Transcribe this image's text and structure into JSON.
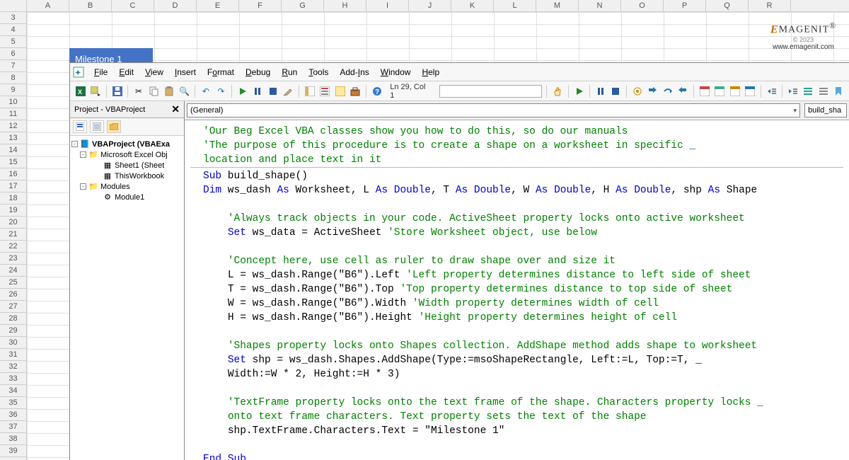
{
  "worksheet": {
    "columns": [
      "A",
      "B",
      "C",
      "D",
      "E",
      "F",
      "G",
      "H",
      "I",
      "J",
      "K",
      "L",
      "M",
      "N",
      "O",
      "P",
      "Q",
      "R"
    ],
    "first_row": 3,
    "last_row": 39,
    "shape_text": "Milestone 1"
  },
  "watermark": {
    "brand_left": "E",
    "brand_right": "MAGENIT",
    "reg": "®",
    "copyright": "© 2023",
    "url": "www.emagenit.com"
  },
  "vbe": {
    "menus": [
      "File",
      "Edit",
      "View",
      "Insert",
      "Format",
      "Debug",
      "Run",
      "Tools",
      "Add-Ins",
      "Window",
      "Help"
    ],
    "menu_underline_index": [
      0,
      0,
      0,
      0,
      1,
      0,
      0,
      0,
      4,
      0,
      0
    ],
    "toolbar_icons": [
      "excel-icon",
      "controls-dropdown-icon",
      "save-icon",
      "sep",
      "cut-icon",
      "copy-icon",
      "paste-icon",
      "find-icon",
      "sep",
      "undo-icon",
      "redo-icon",
      "sep",
      "run-icon",
      "break-icon",
      "reset-icon",
      "design-icon",
      "sep",
      "project-icon",
      "properties-icon",
      "object-browser-icon",
      "toolbox-icon",
      "sep",
      "help-icon"
    ],
    "cursor_pos": "Ln 29, Col 1",
    "toolbar2_icons": [
      "hand-icon",
      "sep",
      "play-icon",
      "sep",
      "pause-icon",
      "stop-icon",
      "sep",
      "toggle-breakpoint-icon",
      "step-into-icon",
      "step-over-icon",
      "step-out-icon",
      "sep",
      "locals-icon",
      "immediate-icon",
      "watch-icon",
      "callstack-icon",
      "sep",
      "outdent-icon",
      "sep",
      "indent-icon",
      "comment-icon",
      "uncomment-icon",
      "bookmark-icon"
    ],
    "project": {
      "title": "Project - VBAProject",
      "root": "VBAProject (VBAExa",
      "folders": {
        "objects": "Microsoft Excel Obj",
        "sheet": "Sheet1 (Sheet",
        "workbook": "ThisWorkbook",
        "modules": "Modules",
        "module1": "Module1"
      }
    },
    "code_dropdowns": {
      "left": "(General)",
      "right": "build_sha"
    },
    "code": {
      "c1": "'Our Beg Excel VBA classes show you how to do this, so do our manuals",
      "c2": "'The purpose of this procedure is to create a shape on a worksheet in specific _",
      "c3": "location and place text in it",
      "sub_kw": "Sub",
      "sub_name": " build_shape()",
      "dim_kw": "Dim",
      "dim_p1": " ws_dash ",
      "as_kw": "As",
      "dim_p2": " Worksheet, L ",
      "dbl_kw": "Double",
      "dim_p3": ", T ",
      "dim_p4": ", W ",
      "dim_p5": ", H ",
      "dim_p6": ", shp ",
      "shape_kw": " Shape",
      "c4": "'Always track objects in your code. ActiveSheet property locks onto active worksheet",
      "set_kw": "Set",
      "set_line": " ws_data = ActiveSheet ",
      "c4b": "'Store Worksheet object, use below",
      "c5": "'Concept here, use cell as ruler to draw shape over and size it",
      "l1a": "L = ws_dash.Range(\"B6\").Left ",
      "l1b": "'Left property determines distance to left side of sheet",
      "l2a": "T = ws_dash.Range(\"B6\").Top ",
      "l2b": "'Top property determines distance to top side of sheet",
      "l3a": "W = ws_dash.Range(\"B6\").Width ",
      "l3b": "'Width property determines width of cell",
      "l4a": "H = ws_dash.Range(\"B6\").Height ",
      "l4b": "'Height property determines height of cell",
      "c6": "'Shapes property locks onto Shapes collection. AddShape method adds shape to worksheet",
      "set2": " shp = ws_dash.Shapes.AddShape(Type:=msoShapeRectangle, Left:=L, Top:=T, _",
      "set2b": "Width:=W * 2, Height:=H * 3)",
      "c7a": "'TextFrame property locks onto the text frame of the shape. Characters property locks _",
      "c7b": "onto text frame characters. Text property sets the text of the shape",
      "tf": "shp.TextFrame.Characters.Text = \"Milestone 1\"",
      "end_kw": "End Sub"
    }
  }
}
